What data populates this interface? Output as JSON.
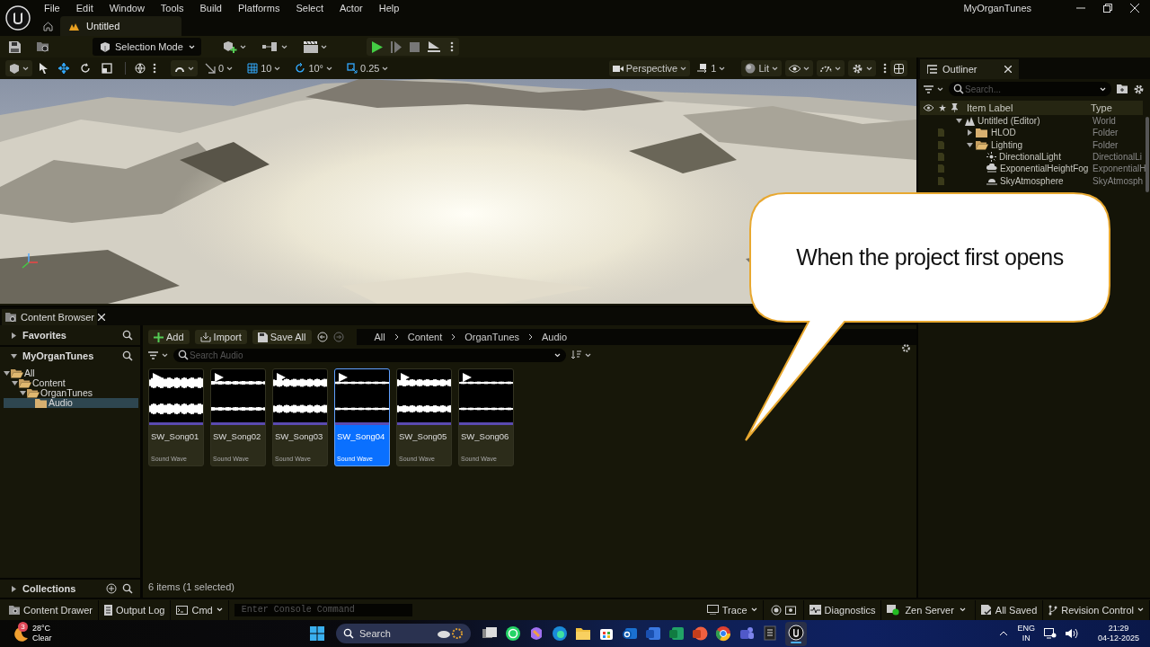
{
  "window": {
    "title": "MyOrganTunes"
  },
  "menu": [
    {
      "label": "File"
    },
    {
      "label": "Edit"
    },
    {
      "label": "Window"
    },
    {
      "label": "Tools"
    },
    {
      "label": "Build"
    },
    {
      "label": "Platforms"
    },
    {
      "label": "Select"
    },
    {
      "label": "Actor"
    },
    {
      "label": "Help"
    }
  ],
  "document_tab": {
    "label": "Untitled"
  },
  "main_toolbar": {
    "mode": "Selection Mode"
  },
  "viewport_toolbar": {
    "snaps": [
      {
        "kind": "surface",
        "value": "0"
      },
      {
        "kind": "grid",
        "value": "10"
      },
      {
        "kind": "rotation",
        "value": "10°"
      },
      {
        "kind": "scale",
        "value": "0.25"
      }
    ],
    "view": "Perspective",
    "camera_speed": "1",
    "view_mode": "Lit"
  },
  "outliner": {
    "tab": "Outliner",
    "search_placeholder": "Search...",
    "columns": [
      "Item Label",
      "Type"
    ],
    "items": [
      {
        "label": "Untitled (Editor)",
        "type": "World",
        "kind": "world",
        "expanded": true,
        "children": [
          {
            "label": "HLOD",
            "type": "Folder",
            "kind": "folder",
            "expanded": false
          },
          {
            "label": "Lighting",
            "type": "Folder",
            "kind": "folder",
            "expanded": true,
            "children": [
              {
                "label": "DirectionalLight",
                "type": "DirectionalLi",
                "kind": "light"
              },
              {
                "label": "ExponentialHeightFog",
                "type": "ExponentialH",
                "kind": "fog"
              },
              {
                "label": "SkyAtmosphere",
                "type": "SkyAtmosph",
                "kind": "sky"
              }
            ]
          }
        ]
      }
    ]
  },
  "content_browser": {
    "tab": "Content Browser",
    "sources": [
      {
        "label": "Favorites",
        "expanded": false
      },
      {
        "label": "MyOrganTunes",
        "expanded": true
      }
    ],
    "folders": [
      {
        "label": "All",
        "expanded": true,
        "selected": false,
        "children": [
          {
            "label": "Content",
            "expanded": true,
            "selected": false,
            "children": [
              {
                "label": "OrganTunes",
                "expanded": true,
                "selected": false,
                "children": [
                  {
                    "label": "Audio",
                    "selected": true
                  }
                ]
              }
            ]
          }
        ]
      }
    ],
    "collections": {
      "label": "Collections",
      "expanded": false
    },
    "actions": [
      {
        "kind": "add",
        "label": "Add"
      },
      {
        "kind": "import",
        "label": "Import"
      },
      {
        "kind": "save",
        "label": "Save All"
      }
    ],
    "path": [
      "All",
      "Content",
      "OrganTunes",
      "Audio"
    ],
    "search_placeholder": "Search Audio",
    "assets": [
      {
        "name": "SW_Song01",
        "type": "Sound Wave",
        "selected": false
      },
      {
        "name": "SW_Song02",
        "type": "Sound Wave",
        "selected": false
      },
      {
        "name": "SW_Song03",
        "type": "Sound Wave",
        "selected": false
      },
      {
        "name": "SW_Song04",
        "type": "Sound Wave",
        "selected": true
      },
      {
        "name": "SW_Song05",
        "type": "Sound Wave",
        "selected": false
      },
      {
        "name": "SW_Song06",
        "type": "Sound Wave",
        "selected": false
      }
    ],
    "summary": "6 items (1 selected)"
  },
  "status_bar": {
    "left": [
      {
        "kind": "drawer",
        "label": "Content Drawer"
      },
      {
        "kind": "log",
        "label": "Output Log"
      },
      {
        "kind": "cmd",
        "label": "Cmd"
      }
    ],
    "console_placeholder": "Enter Console Command",
    "right": [
      {
        "kind": "trace",
        "label": "Trace"
      },
      {
        "kind": "diagnostics",
        "label": "Diagnostics"
      },
      {
        "kind": "server",
        "label": "Zen Server"
      },
      {
        "kind": "saved",
        "label": "All Saved"
      },
      {
        "kind": "revision",
        "label": "Revision Control"
      }
    ]
  },
  "taskbar": {
    "weather": {
      "temperature": "28°C",
      "condition": "Clear",
      "badge": "3"
    },
    "search": "Search",
    "language": "ENG",
    "region": "IN",
    "time": "21:29",
    "date": "04-12-2025"
  },
  "callout": {
    "text": "When the project first opens"
  }
}
